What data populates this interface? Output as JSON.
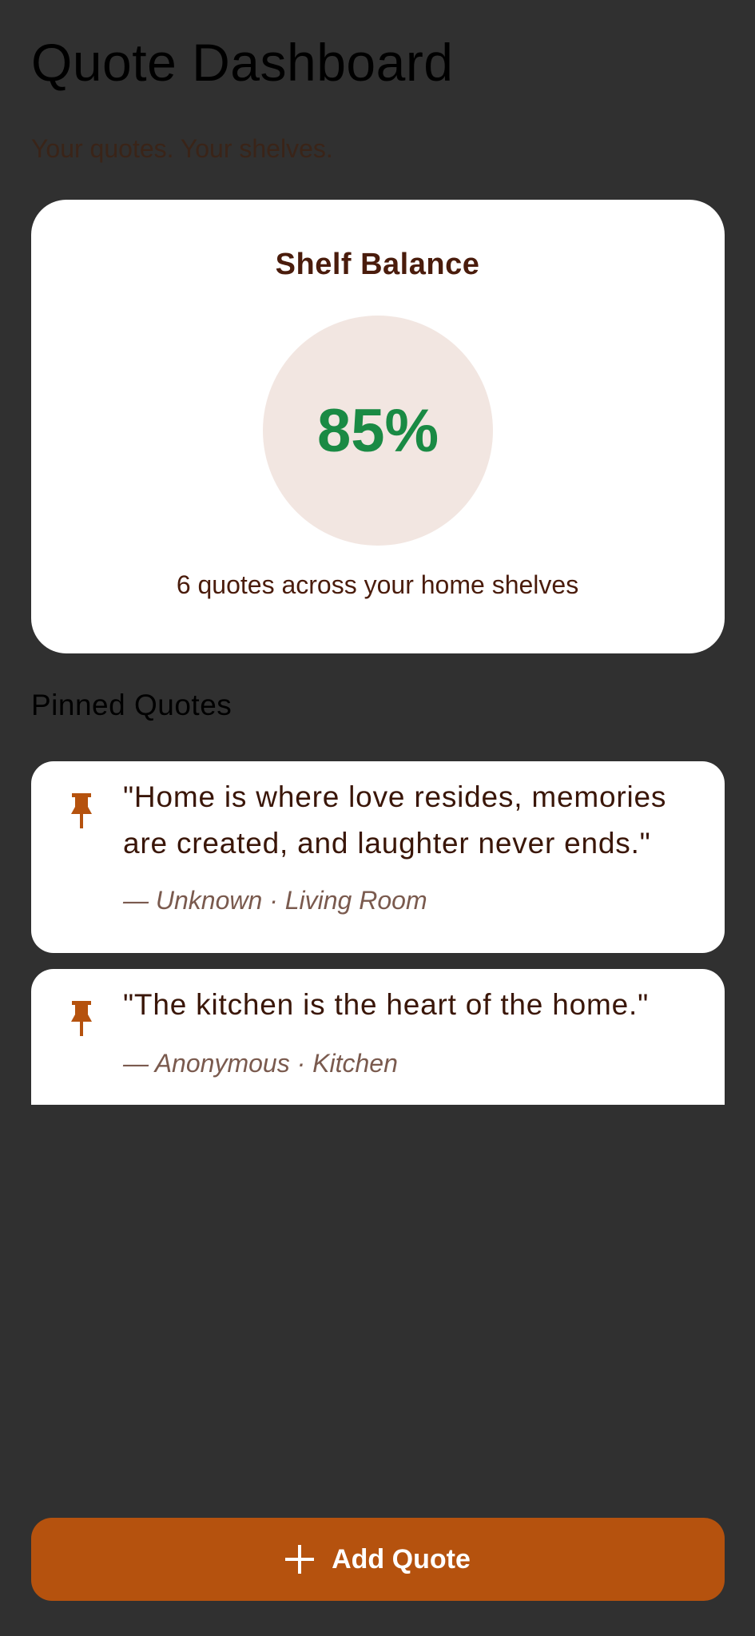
{
  "header": {
    "title": "Quote Dashboard",
    "subtitle": "Your quotes. Your shelves."
  },
  "balance": {
    "title": "Shelf Balance",
    "value": "85%",
    "caption": "6 quotes across your home shelves"
  },
  "pinned": {
    "heading": "Pinned Quotes",
    "items": [
      {
        "text": "\"Home is where love resides, memories are created, and laughter never ends.\"",
        "meta": "— Unknown · Living Room",
        "icon": "pin-icon"
      },
      {
        "text": "\"The kitchen is the heart of the home.\"",
        "meta": "— Anonymous · Kitchen",
        "icon": "pin-icon"
      }
    ]
  },
  "actions": {
    "add_label": "Add Quote",
    "add_icon": "plus-icon"
  },
  "colors": {
    "background": "#303030",
    "card": "#ffffff",
    "accent": "#b5520e",
    "positive": "#1a8a44",
    "pin": "#b5520e"
  }
}
